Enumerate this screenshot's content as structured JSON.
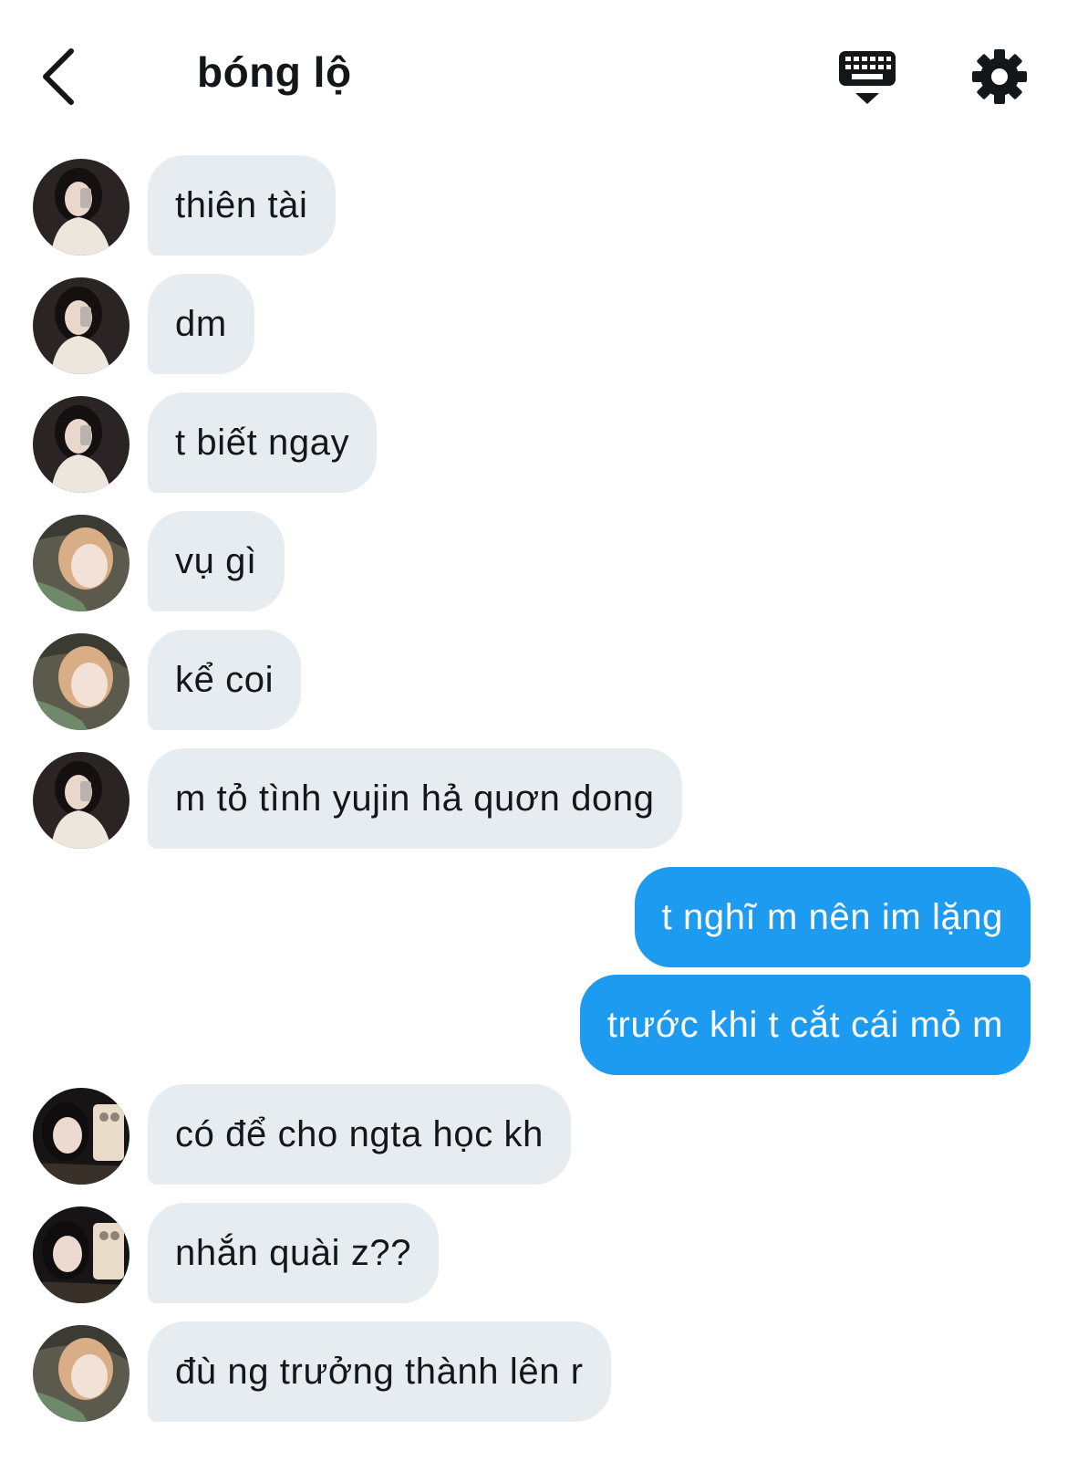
{
  "header": {
    "title": "bóng lộ",
    "back_icon": "chevron-left-icon",
    "keyboard_icon": "keyboard-icon",
    "settings_icon": "gear-icon"
  },
  "colors": {
    "incoming_bubble": "#e6ecf0",
    "outgoing_bubble": "#1d9bf0",
    "text": "#14171a"
  },
  "messages": [
    {
      "direction": "incoming",
      "avatar": "user-a",
      "text": "thiên tài"
    },
    {
      "direction": "incoming",
      "avatar": "user-a",
      "text": "dm"
    },
    {
      "direction": "incoming",
      "avatar": "user-a",
      "text": "t biết ngay"
    },
    {
      "direction": "incoming",
      "avatar": "user-b",
      "text": "vụ gì"
    },
    {
      "direction": "incoming",
      "avatar": "user-b",
      "text": "kể coi"
    },
    {
      "direction": "incoming",
      "avatar": "user-a",
      "text": "m tỏ tình yujin hả quơn dong"
    },
    {
      "direction": "outgoing",
      "text": "t nghĩ m nên im lặng"
    },
    {
      "direction": "outgoing",
      "text": "trước khi t cắt cái mỏ m"
    },
    {
      "direction": "incoming",
      "avatar": "user-c",
      "text": "có để cho ngta học kh"
    },
    {
      "direction": "incoming",
      "avatar": "user-c",
      "text": "nhắn quài z??"
    },
    {
      "direction": "incoming",
      "avatar": "user-b",
      "text": "đù ng trưởng thành lên r"
    }
  ]
}
